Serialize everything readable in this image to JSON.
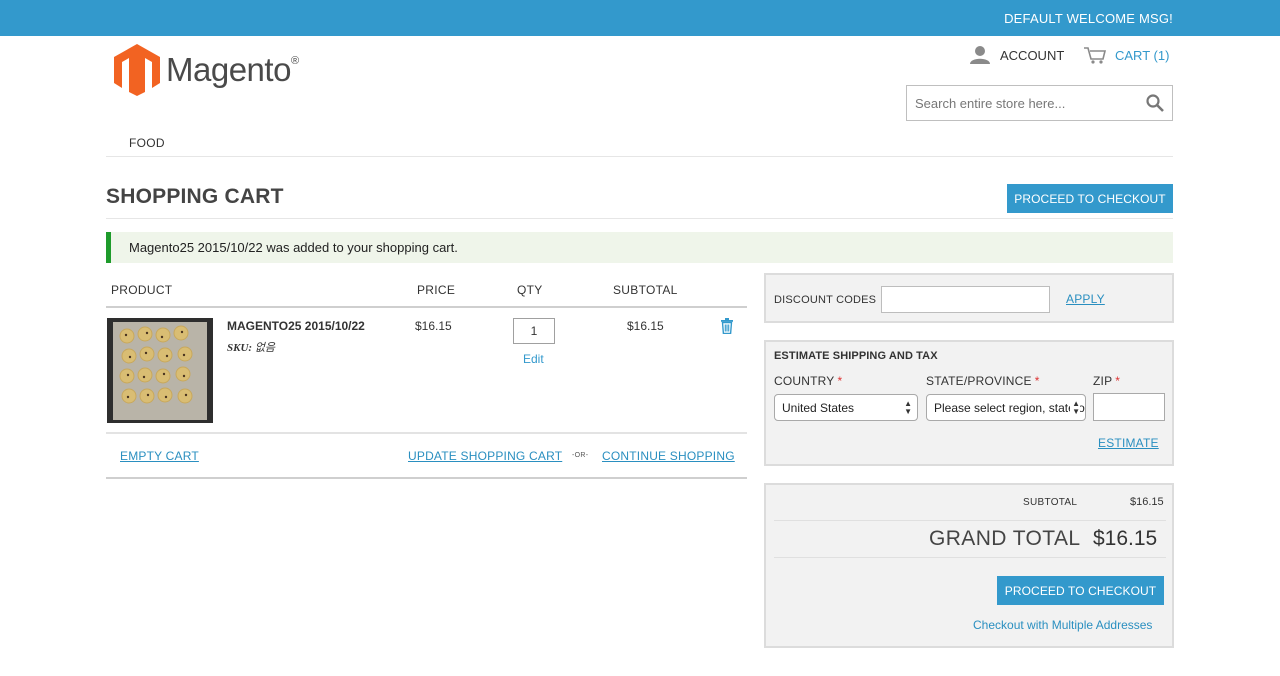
{
  "topbar": {
    "welcome": "DEFAULT WELCOME MSG!"
  },
  "logo": {
    "text": "Magento"
  },
  "header": {
    "account_label": "ACCOUNT",
    "cart_label": "CART (1)",
    "search_placeholder": "Search entire store here..."
  },
  "nav": {
    "items": [
      "FOOD"
    ]
  },
  "page": {
    "title": "SHOPPING CART",
    "proceed_label": "PROCEED TO CHECKOUT",
    "message": "Magento25 2015/10/22 was added to your shopping cart."
  },
  "cart": {
    "columns": [
      "PRODUCT",
      "PRICE",
      "QTY",
      "SUBTOTAL"
    ],
    "items": [
      {
        "name": "MAGENTO25 2015/10/22",
        "sku_label": "SKU:",
        "sku": "없음",
        "price": "$16.15",
        "qty": "1",
        "edit_label": "Edit",
        "subtotal": "$16.15"
      }
    ],
    "empty_label": "EMPTY CART",
    "update_label": "UPDATE SHOPPING CART",
    "or_label": "-OR-",
    "continue_label": "CONTINUE SHOPPING"
  },
  "discount": {
    "label": "DISCOUNT CODES",
    "value": "",
    "apply_label": "APPLY"
  },
  "estimate": {
    "title": "ESTIMATE SHIPPING AND TAX",
    "country_label": "COUNTRY",
    "country_value": "United States",
    "region_label": "STATE/PROVINCE",
    "region_value": "Please select region, state or province",
    "zip_label": "ZIP",
    "zip_value": "",
    "required_mark": "*",
    "estimate_label": "ESTIMATE"
  },
  "totals": {
    "subtotal_label": "SUBTOTAL",
    "subtotal_value": "$16.15",
    "grand_total_label": "GRAND TOTAL",
    "grand_total_value": "$16.15",
    "proceed_label": "PROCEED TO CHECKOUT",
    "multi_label": "Checkout with Multiple Addresses"
  },
  "colors": {
    "brand_blue": "#3399cc",
    "logo_orange": "#f26322",
    "success_green": "#1e9b2b"
  }
}
